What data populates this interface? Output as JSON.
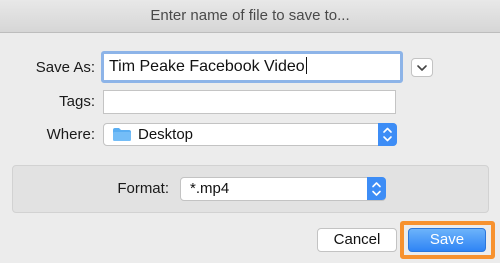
{
  "dialog": {
    "title": "Enter name of file to save to..."
  },
  "save_as": {
    "label": "Save As:",
    "value": "Tim Peake Facebook Video"
  },
  "tags": {
    "label": "Tags:",
    "value": ""
  },
  "where": {
    "label": "Where:",
    "selected": "Desktop",
    "icon": "folder-icon"
  },
  "format": {
    "label": "Format:",
    "selected": "*.mp4"
  },
  "buttons": {
    "cancel": "Cancel",
    "save": "Save"
  },
  "colors": {
    "accent": "#3d8df6",
    "highlight": "#f7922f"
  }
}
